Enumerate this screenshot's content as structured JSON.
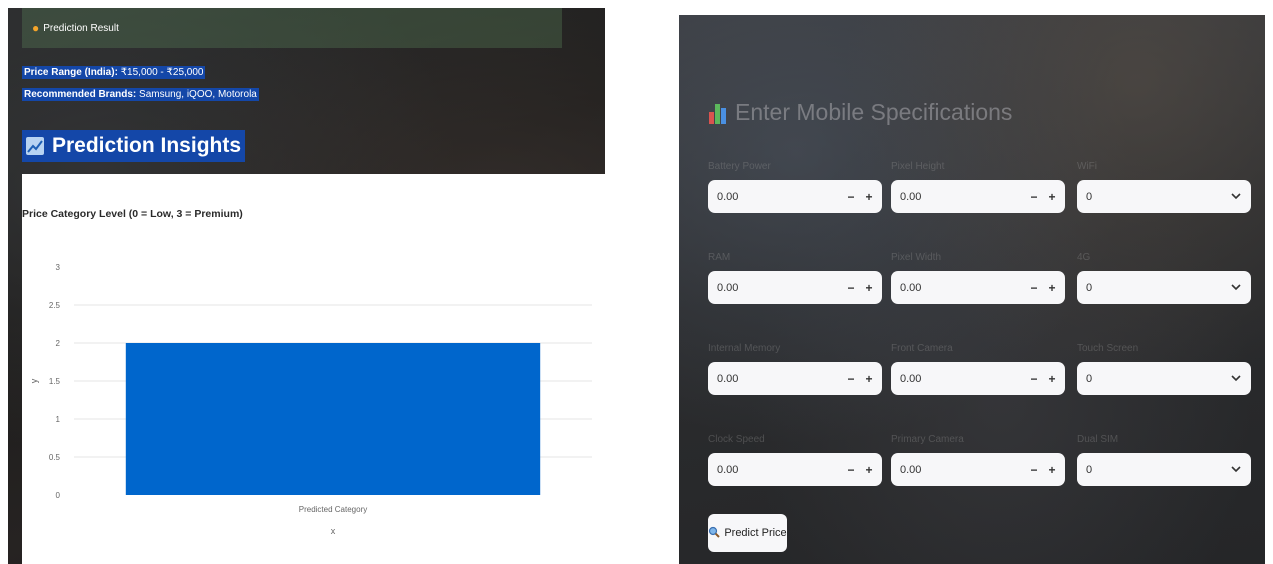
{
  "result": {
    "title": "Prediction Result",
    "price_range_label": "Price Range (India):",
    "price_range_value": "₹15,000 - ₹25,000",
    "brands_label": "Recommended Brands:",
    "brands_value": "Samsung, iQOO, Motorola"
  },
  "insights": {
    "title": "Prediction Insights"
  },
  "chart_data": {
    "type": "bar",
    "title": "Price Category Level (0 = Low, 3 = Premium)",
    "categories": [
      "Predicted Category"
    ],
    "values": [
      2
    ],
    "ylim": [
      0,
      3
    ],
    "yticks": [
      "0",
      "0.5",
      "1",
      "1.5",
      "2",
      "2.5",
      "3"
    ],
    "xlabel": "x",
    "ylabel": "y",
    "bar_color": "#0066cc"
  },
  "form": {
    "title": "Enter Mobile Specifications",
    "fields": [
      {
        "label": "Battery Power",
        "value": "0.00",
        "kind": "number"
      },
      {
        "label": "Pixel Height",
        "value": "0.00",
        "kind": "number"
      },
      {
        "label": "WiFi",
        "value": "0",
        "kind": "select"
      },
      {
        "label": "RAM",
        "value": "0.00",
        "kind": "number"
      },
      {
        "label": "Pixel Width",
        "value": "0.00",
        "kind": "number"
      },
      {
        "label": "4G",
        "value": "0",
        "kind": "select"
      },
      {
        "label": "Internal Memory",
        "value": "0.00",
        "kind": "number"
      },
      {
        "label": "Front Camera",
        "value": "0.00",
        "kind": "number"
      },
      {
        "label": "Touch Screen",
        "value": "0",
        "kind": "select"
      },
      {
        "label": "Clock Speed",
        "value": "0.00",
        "kind": "number"
      },
      {
        "label": "Primary Camera",
        "value": "0.00",
        "kind": "number"
      },
      {
        "label": "Dual SIM",
        "value": "0",
        "kind": "select"
      }
    ],
    "stepper_minus": "−",
    "stepper_plus": "+",
    "predict_button": "Predict Price"
  },
  "colors": {
    "accent_blue": "#1447a8",
    "bar_blue": "#0066cc"
  }
}
